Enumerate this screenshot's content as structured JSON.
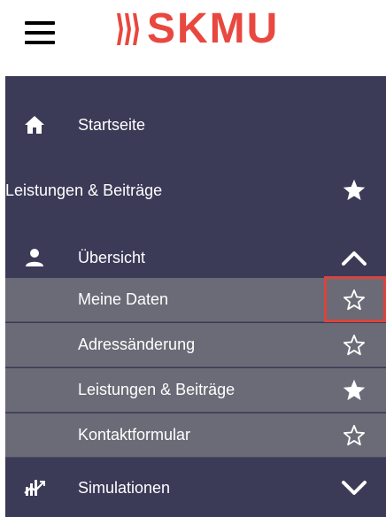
{
  "header": {
    "logo_text": "SKMU",
    "menu_icon": "hamburger-icon",
    "brand_color": "#e8483f"
  },
  "menu": {
    "items": [
      {
        "label": "Startseite",
        "icon": "home-icon"
      },
      {
        "label": "Leistungen & Beiträge",
        "right_icon": "star-filled-icon"
      },
      {
        "label": "Übersicht",
        "icon": "user-icon",
        "right_icon": "chevron-up-icon"
      },
      {
        "label": "Simulationen",
        "icon": "chart-icon",
        "right_icon": "chevron-down-icon"
      }
    ],
    "subitems": [
      {
        "label": "Meine Daten",
        "star": "star-outline-icon",
        "highlighted": true
      },
      {
        "label": "Adressänderung",
        "star": "star-outline-icon"
      },
      {
        "label": "Leistungen & Beiträge",
        "star": "star-filled-icon"
      },
      {
        "label": "Kontaktformular",
        "star": "star-outline-icon"
      }
    ]
  },
  "colors": {
    "menu_bg": "#3b3a57",
    "submenu_bg": "#6b6b77",
    "highlight": "#d9453c"
  }
}
